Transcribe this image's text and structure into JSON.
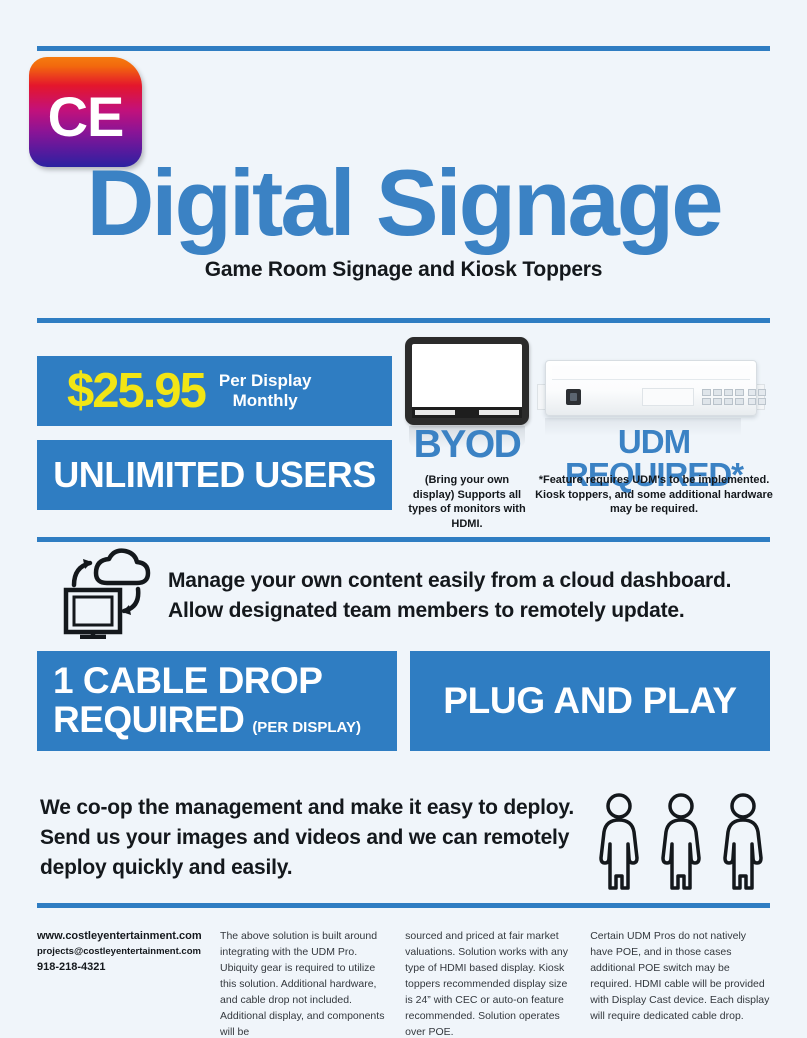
{
  "brand": {
    "logo_text": "CE"
  },
  "header": {
    "title": "Digital Signage",
    "subtitle": "Game Room Signage and Kiosk Toppers"
  },
  "pricing": {
    "amount": "$25.95",
    "term_line1": "Per Display",
    "term_line2": "Monthly",
    "users_label": "UNLIMITED USERS"
  },
  "hardware": {
    "byod": {
      "heading": "BYOD",
      "icon": "monitor-icon",
      "note": "(Bring your own display) Supports all types of monitors with HDMI."
    },
    "udm": {
      "heading": "UDM REQUIRED*",
      "icon": "udm-rack-device-icon",
      "note": "*Feature requires UDM's to be implemented. Kiosk toppers, and some additional hardware may be required."
    }
  },
  "cloud": {
    "icon": "cloud-sync-monitor-icon",
    "line1": "Manage your own content easily from a cloud dashboard.",
    "line2": "Allow designated team members to remotely update."
  },
  "banners": {
    "cable_line1": "1 CABLE DROP",
    "cable_line2_big": "REQUIRED",
    "cable_line2_small": "(PER DISPLAY)",
    "plug": "PLUG AND PLAY"
  },
  "coop": {
    "line1": "We co-op the management and make it easy to deploy.",
    "line2": "Send us your images and videos and we can remotely",
    "line3": "deploy quickly and easily.",
    "icon": "three-people-icon"
  },
  "footer": {
    "website": "www.costleyentertainment.com",
    "email": "projects@costleyentertainment.com",
    "phone": "918-218-4321",
    "fine_print_1": "The above solution is built around integrating with the UDM Pro. Ubiquity gear is required to utilize this solution. Additional hardware, and cable drop not included. Additional display, and components will be",
    "fine_print_2": "sourced and priced at fair market valuations. Solution works with any type of HDMI based display. Kiosk toppers recommended display size is 24” with CEC or auto-on feature recommended. Solution operates over POE.",
    "fine_print_3": "Certain UDM Pros do not natively have POE, and in those cases additional POE switch may be required. HDMI cable will be provided with Display Cast device. Each display will require dedicated cable drop."
  },
  "colors": {
    "accent_blue": "#2f7dc2",
    "title_blue": "#3b82c4",
    "price_yellow": "#f2e515",
    "background": "#f0f5fa"
  }
}
